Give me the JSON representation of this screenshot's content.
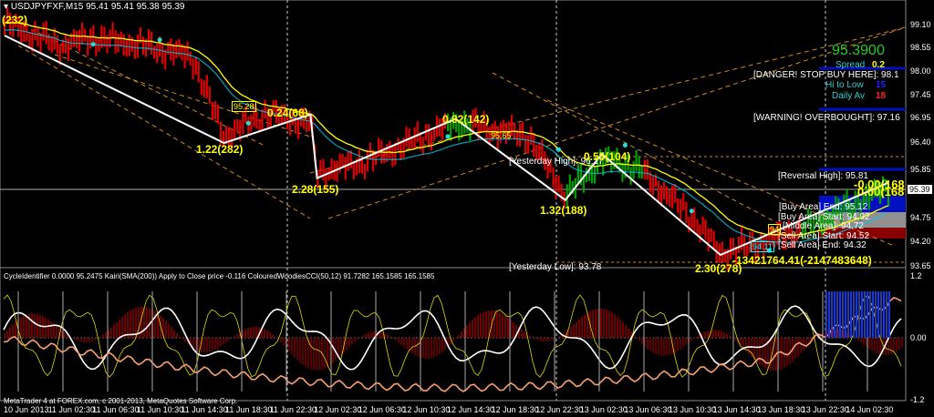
{
  "header": {
    "symbol": "USDJPYFXF,M15",
    "ohlc": "95.41 95.41 95.38 95.39"
  },
  "info_panel": {
    "price": "95.3900",
    "spread_label": "Spread",
    "spread": "0.2",
    "hi_low_label": "Hi to Low",
    "hi_low": "15",
    "daily_av_label": "Daily Av",
    "daily_av": "18"
  },
  "levels": {
    "danger": "[DANGER! STOP BUY HERE]: 98.1",
    "warning": "[WARNING! OVERBOUGHT]: 97.16",
    "reversal_high": "[Reversal High]: 95.81",
    "buy_end": "[Buy Area] End: 95.12",
    "buy_start": "[Buy Area] Start: 94.92",
    "middle": "[Middle Area]: 94.72",
    "sell_start": "[Sell Area] Start: 94.52",
    "sell_end": "[Sell Area] End: 94.32",
    "yesterday_high": "[Yesterday High]: 96.17",
    "yesterday_low": "[Yesterday Low]: 93.78"
  },
  "zigzag_labels": [
    "(232)",
    "1.22(282)",
    "0.24(68)",
    "2.28(155)",
    "0.92(142)",
    "1.32(188)",
    "0.55(104)",
    "2.30(278)",
    "-13421764.41(-2147483648)",
    "-0.00(168",
    "0.00(168"
  ],
  "price_boxes": [
    "95.28",
    "95.65",
    "94.11",
    "94"
  ],
  "price_axis": [
    "99.10",
    "98.55",
    "98.00",
    "97.45",
    "96.95",
    "96.40",
    "95.85",
    "94.75",
    "94.20",
    "93.65"
  ],
  "current_price": "95.39",
  "osc_axis": [
    "1.2",
    "0.00",
    "-1.2"
  ],
  "indicator_header": "CycleIdentifier 0.0000 95.2475  Kairi(SMA(200)) Apply to Close price -0.116  ColouredWoodiesCCI(50,12) 91.7282 165.1585 165.1585",
  "copyright": "MetaTrader 4 at FOREX.com, c 2001-2013, MetaQuotes Software Corp.",
  "time_axis": [
    "10 Jun 2013",
    "11 Jun 02:30",
    "11 Jun 06:30",
    "11 Jun 10:30",
    "11 Jun 14:30",
    "11 Jun 18:30",
    "11 Jun 22:30",
    "12 Jun 02:30",
    "12 Jun 06:30",
    "12 Jun 10:30",
    "12 Jun 14:30",
    "12 Jun 18:30",
    "12 Jun 22:30",
    "13 Jun 02:30",
    "13 Jun 06:30",
    "13 Jun 10:30",
    "13 Jun 14:30",
    "13 Jun 18:30",
    "13 Jun 22:30",
    "14 Jun 02:30"
  ],
  "chart_data": {
    "type": "candlestick-approx",
    "price_range": [
      93.6,
      99.3
    ],
    "price_path_hours_price": [
      [
        0,
        99.19
      ],
      [
        4.9,
        98.67
      ],
      [
        7.8,
        98.84
      ],
      [
        11.9,
        98.7
      ],
      [
        16.9,
        98.42
      ],
      [
        19.8,
        96.6
      ],
      [
        23.5,
        97.12
      ],
      [
        27.6,
        96.91
      ],
      [
        28.2,
        95.77
      ],
      [
        32.5,
        96.02
      ],
      [
        40.7,
        96.91
      ],
      [
        47.3,
        96.6
      ],
      [
        50.6,
        95.25
      ],
      [
        53.9,
        96.08
      ],
      [
        57.2,
        95.87
      ],
      [
        62.1,
        94.73
      ],
      [
        64.6,
        93.94
      ],
      [
        68.7,
        94.21
      ],
      [
        72,
        94.48
      ],
      [
        78.6,
        95.31
      ],
      [
        79.8,
        95.45
      ]
    ],
    "green_hour_ranges": [
      [
        40,
        42
      ],
      [
        50.6,
        57.5
      ],
      [
        72,
        80
      ]
    ],
    "colors": {
      "bear": "#e00000",
      "bull": "#00a000",
      "ma": "#ffff00",
      "ma2": "#00c8e8",
      "zigzag": "#ffffff",
      "channel": "#d08a20",
      "blue_level": "#0010c0"
    }
  }
}
